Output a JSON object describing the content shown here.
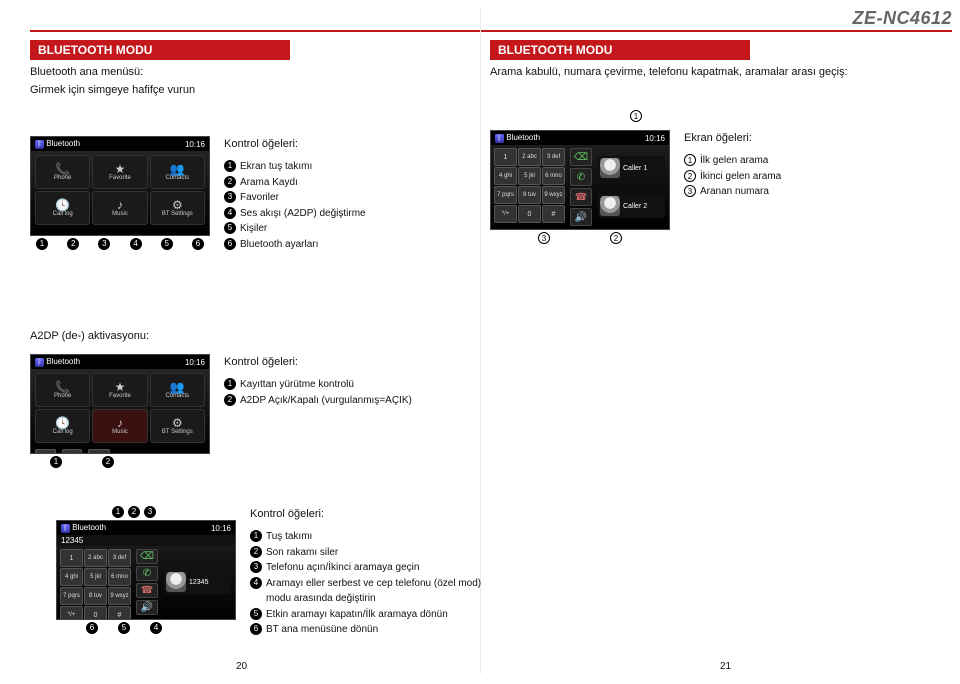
{
  "model": "ZE-NC4612",
  "left": {
    "banner": "BLUETOOTH MODU",
    "sub1": "Bluetooth ana menüsü:",
    "sub2": "Girmek için simgeye hafifçe vurun",
    "screen1": {
      "title": "Bluetooth",
      "time": "10:16",
      "cells": [
        "Phone",
        "Favorite",
        "Contacts",
        "Call log",
        "Music",
        "BT Settings"
      ]
    },
    "legend1_title": "Kontrol öğeleri:",
    "legend1": [
      "Ekran tuş takımı",
      "Arama Kaydı",
      "Favoriler",
      "Ses akışı (A2DP) değiştirme",
      "Kişiler",
      "Bluetooth ayarları"
    ],
    "a2dp_title": "A2DP (de-) aktivasyonu:",
    "legend2_title": "Kontrol öğeleri:",
    "legend2": [
      "Kayıttan yürütme kontrolü",
      "A2DP Açık/Kapalı (vurgulanmış=AÇIK)"
    ]
  },
  "right": {
    "banner": "BLUETOOTH MODU",
    "sub1": "Arama kabulü, numara çevirme, telefonu kapatmak, aramalar arası geçiş:",
    "dial1": {
      "title": "Bluetooth",
      "time": "10:16",
      "keys": [
        "1",
        "2 abc",
        "3 def",
        "4 ghi",
        "5 jkl",
        "6 mno",
        "7 pqrs",
        "8 tuv",
        "9 wxyz",
        "*/+",
        "0",
        "#"
      ],
      "caller1": "Caller 1",
      "caller2": "Caller 2",
      "callouts": [
        "1",
        "2",
        "3"
      ]
    },
    "legend1_title": "Ekran öğeleri:",
    "legend1": [
      "İlk gelen arama",
      "İkinci gelen arama",
      "Aranan numara"
    ],
    "dial2": {
      "title": "Bluetooth",
      "time": "10:16",
      "num": "12345",
      "num2": "12345"
    },
    "legend2_title": "Kontrol öğeleri:",
    "legend2": [
      "Tuş takımı",
      "Son rakamı siler",
      "Telefonu açın/İkinci aramaya geçin",
      "Aramayı eller serbest ve cep telefonu (özel mod) modu arasında değiştirin",
      "Etkin aramayı kapatın/İlk aramaya dönün",
      "BT ana menüsüne dönün"
    ]
  },
  "page_left": "20",
  "page_right": "21"
}
